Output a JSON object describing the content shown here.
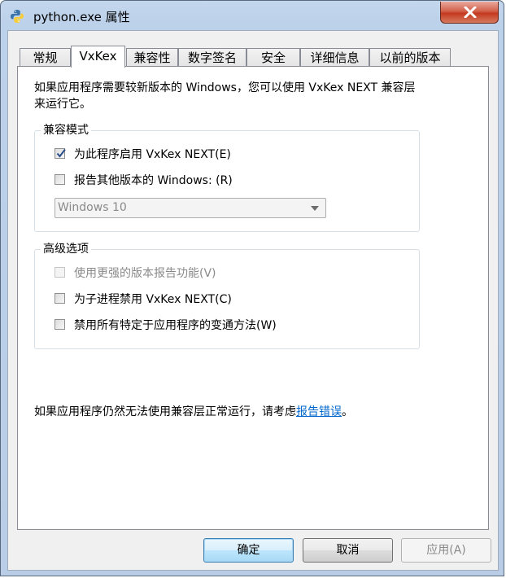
{
  "window": {
    "title": "python.exe 属性",
    "close_glyph": "✕"
  },
  "tabs": [
    {
      "label": "常规",
      "active": false
    },
    {
      "label": "VxKex",
      "active": true
    },
    {
      "label": "兼容性",
      "active": false
    },
    {
      "label": "数字签名",
      "active": false
    },
    {
      "label": "安全",
      "active": false
    },
    {
      "label": "详细信息",
      "active": false
    },
    {
      "label": "以前的版本",
      "active": false
    }
  ],
  "panel": {
    "description": "如果应用程序需要较新版本的 Windows，您可以使用 VxKex NEXT 兼容层来运行它。",
    "compat_group": {
      "title": "兼容模式",
      "enable_vxkex": {
        "label": "为此程序启用 VxKex NEXT(E)",
        "checked": true
      },
      "report_version": {
        "label": "报告其他版本的 Windows: (R)",
        "checked": false
      },
      "version_select": {
        "value": "Windows 10",
        "enabled": false
      }
    },
    "advanced_group": {
      "title": "高级选项",
      "stronger_reporting": {
        "label": "使用更强的版本报告功能(V)",
        "checked": false,
        "enabled": false
      },
      "disable_for_children": {
        "label": "为子进程禁用 VxKex NEXT(C)",
        "checked": false
      },
      "disable_app_shims": {
        "label": "禁用所有特定于应用程序的变通方法(W)",
        "checked": false
      }
    },
    "footer_text": "如果应用程序仍然无法使用兼容层正常运行，请考虑",
    "footer_link": "报告错误",
    "footer_end": "。"
  },
  "buttons": {
    "ok": "确定",
    "cancel": "取消",
    "apply": "应用(A)"
  },
  "colors": {
    "titlebar": "#bcd1ea",
    "close_button": "#c4391f",
    "link": "#0066cc",
    "default_button_border": "#3c7fb1"
  },
  "icons": {
    "app": "python-icon",
    "close": "close-icon",
    "check": "checkmark-icon",
    "dropdown": "chevron-down-icon"
  }
}
